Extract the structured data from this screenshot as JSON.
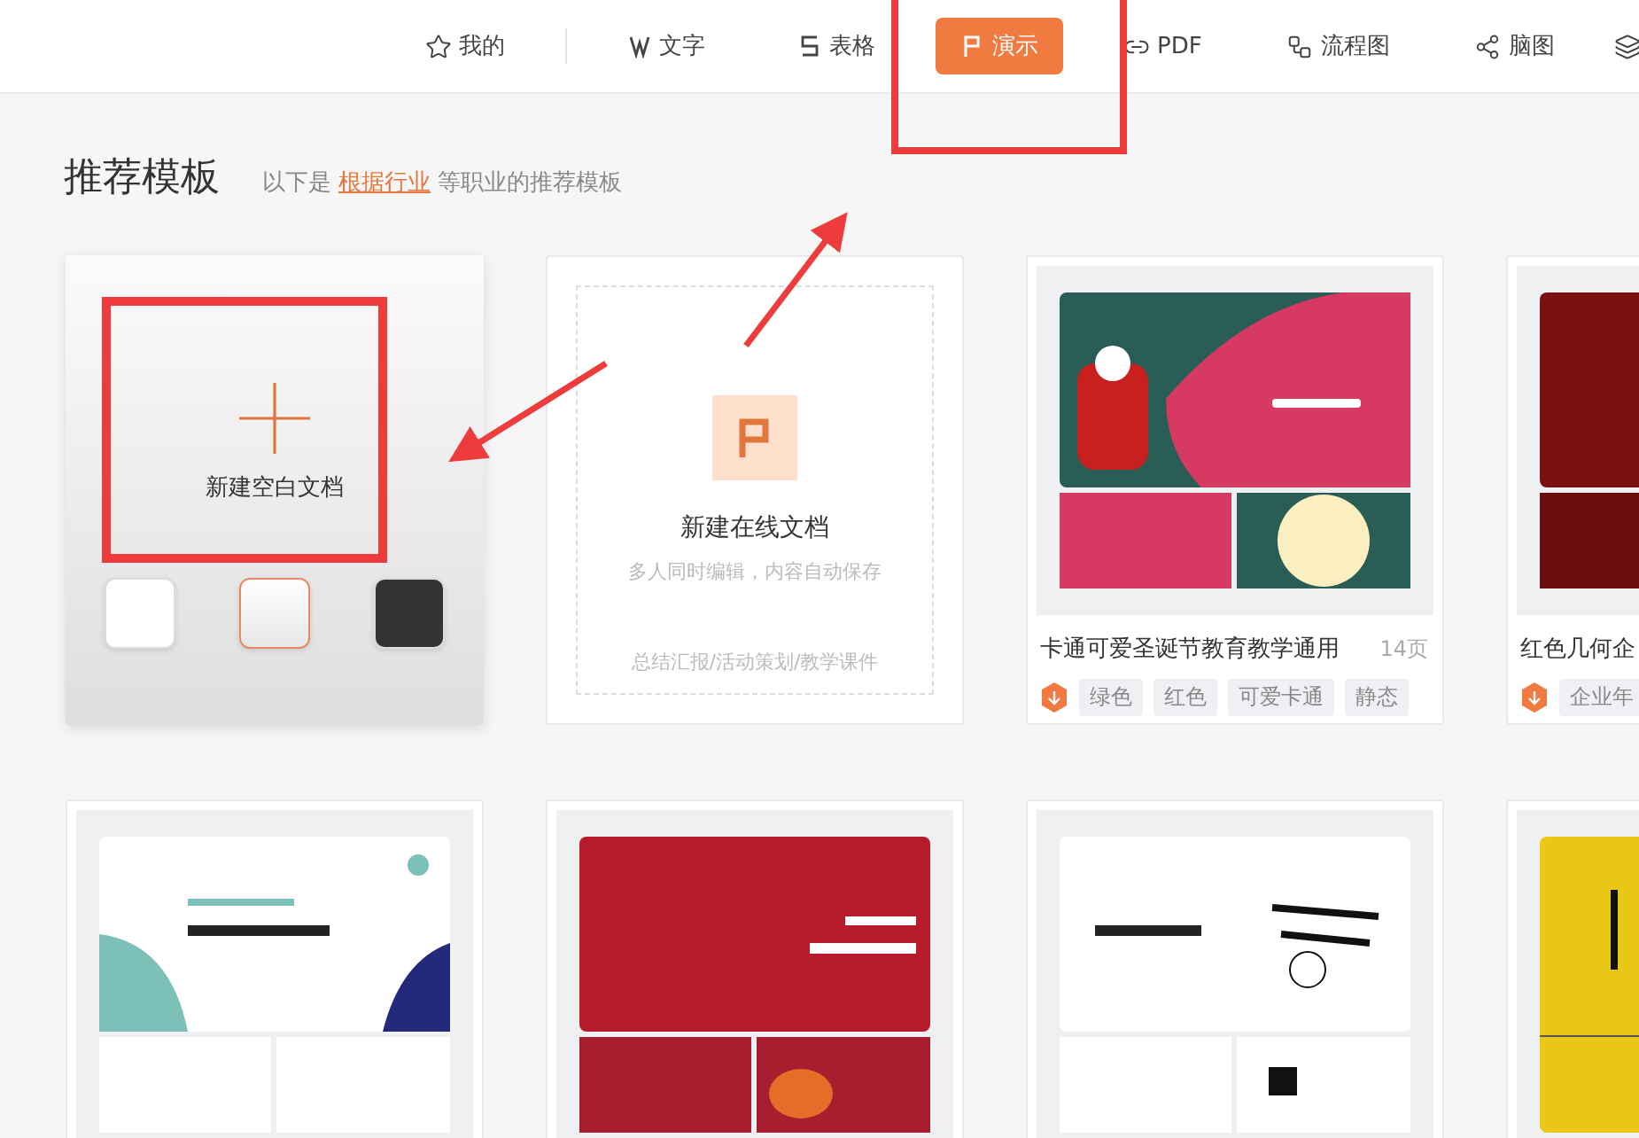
{
  "nav": {
    "tabs": [
      {
        "label": "我的",
        "kind": "star",
        "selected": false
      },
      {
        "label": "文字",
        "kind": "w",
        "selected": false
      },
      {
        "label": "表格",
        "kind": "s",
        "selected": false
      },
      {
        "label": "演示",
        "kind": "p",
        "selected": true
      },
      {
        "label": "PDF",
        "kind": "link",
        "selected": false
      },
      {
        "label": "流程图",
        "kind": "flow",
        "selected": false
      },
      {
        "label": "脑图",
        "kind": "mind",
        "selected": false
      }
    ]
  },
  "heading": {
    "title": "推荐模板",
    "prefix": "以下是",
    "link": "根据行业",
    "suffix": "等职业的推荐模板"
  },
  "blank_card": {
    "label": "新建空白文档",
    "themes": [
      {
        "kind": "white",
        "selected": false
      },
      {
        "kind": "light",
        "selected": true
      },
      {
        "kind": "dark",
        "selected": false
      }
    ]
  },
  "online_card": {
    "title": "新建在线文档",
    "subtitle": "多人同时编辑，内容自动保存",
    "footer": "总结汇报/活动策划/教学课件"
  },
  "templates": [
    {
      "kind": "christmas",
      "title": "卡通可爱圣诞节教育教学通用",
      "pages": "14页",
      "tags": [
        "绿色",
        "红色",
        "可爱卡通",
        "静态"
      ]
    },
    {
      "kind": "darkred",
      "title": "红色几何企",
      "tags": [
        "企业年"
      ]
    },
    {
      "kind": "report"
    },
    {
      "kind": "annual"
    },
    {
      "kind": "business"
    },
    {
      "kind": "yellow"
    }
  ]
}
